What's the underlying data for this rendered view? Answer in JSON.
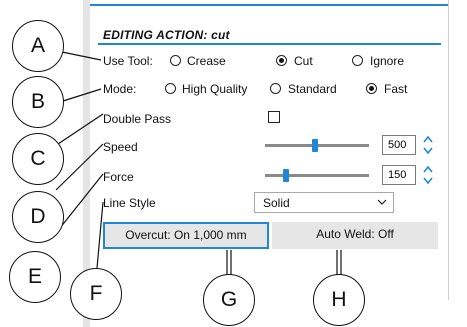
{
  "panel": {
    "title": "EDITING ACTION: cut",
    "use_tool": {
      "label": "Use Tool:",
      "options": [
        "Crease",
        "Cut",
        "Ignore"
      ],
      "selected": "Cut"
    },
    "mode": {
      "label": "Mode:",
      "options": [
        "High Quality",
        "Standard",
        "Fast"
      ],
      "selected": "Fast"
    },
    "double_pass": {
      "label": "Double Pass",
      "checked": false
    },
    "speed": {
      "label": "Speed",
      "value": "500",
      "slider_fraction": 0.48
    },
    "force": {
      "label": "Force",
      "value": "150",
      "slider_fraction": 0.2
    },
    "line_style": {
      "label": "Line Style",
      "value": "Solid"
    },
    "overcut_button": "Overcut: On 1,000 mm",
    "auto_weld_button": "Auto Weld: Off"
  },
  "callouts": [
    "A",
    "B",
    "C",
    "D",
    "E",
    "F",
    "G",
    "H"
  ],
  "colors": {
    "accent": "#1f87d4",
    "button_bg": "#e6e6e6",
    "stripe": "#e4e4e4"
  }
}
